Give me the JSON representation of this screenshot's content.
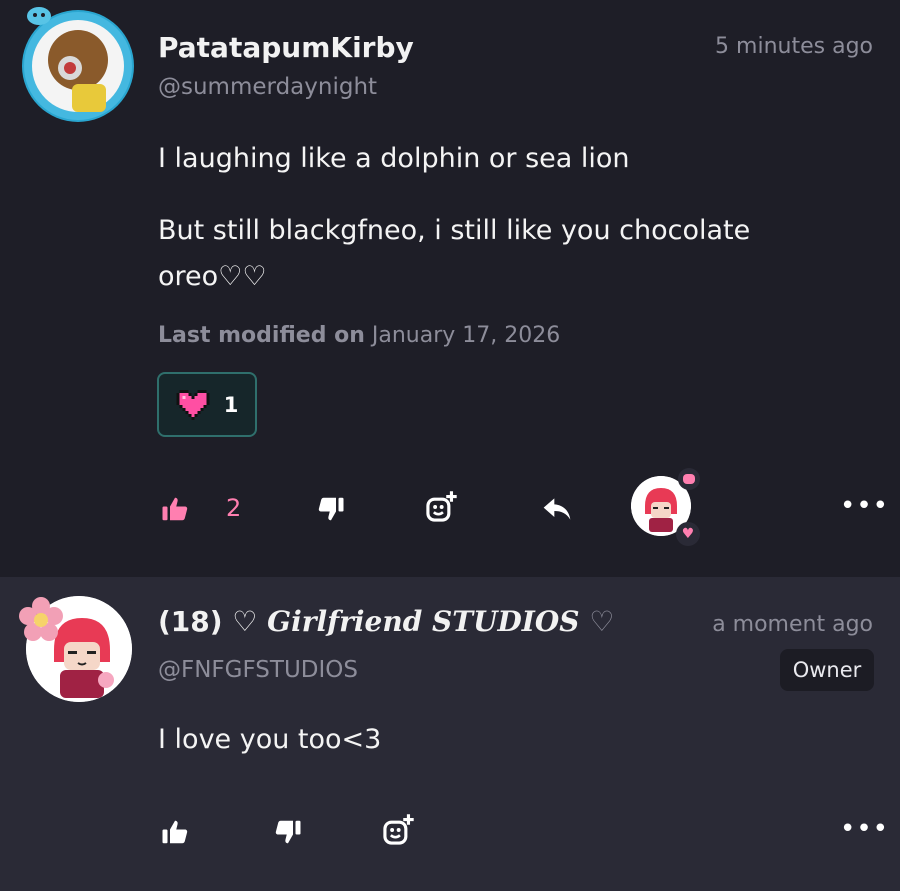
{
  "post": {
    "author_name": "PatatapumKirby",
    "author_handle": "@summerdaynight",
    "timestamp": "5 minutes ago",
    "body_line1": "I laughing like a dolphin or sea lion",
    "body_line2a": "But still blackgfneo, i still like you chocolate",
    "body_line2b": "oreo♡♡",
    "modified_label": "Last modified on",
    "modified_date": "January 17, 2026",
    "reaction_count": "1",
    "like_count": "2",
    "more_label": "•••"
  },
  "reply": {
    "author_prefix": "(18) ♡",
    "author_styled": "Girlfriend STUDIOS",
    "author_suffix": "♡",
    "author_handle": "@FNFGFSTUDIOS",
    "timestamp": "a moment ago",
    "badge": "Owner",
    "body": "I love you too<3",
    "more_label": "•••"
  },
  "colors": {
    "accent_pink": "#ff7fb0",
    "heart_pink": "#ff4fa3",
    "chip_border": "#2f6f6c"
  }
}
